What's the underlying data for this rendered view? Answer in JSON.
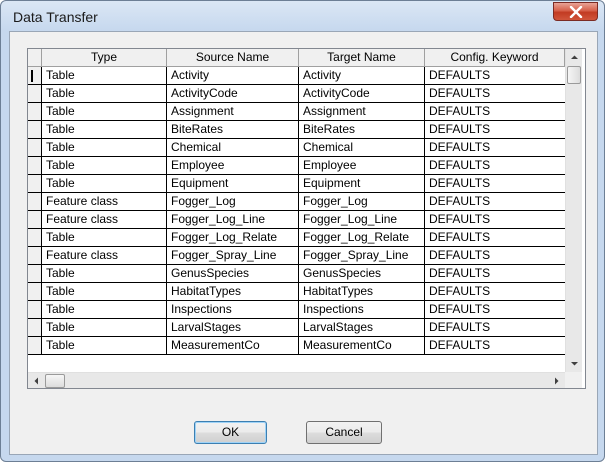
{
  "dialog": {
    "title": "Data Transfer",
    "ok_label": "OK",
    "cancel_label": "Cancel"
  },
  "grid": {
    "columns": [
      "Type",
      "Source Name",
      "Target Name",
      "Config. Keyword"
    ],
    "rows": [
      [
        "Table",
        "Activity",
        "Activity",
        "DEFAULTS"
      ],
      [
        "Table",
        "ActivityCode",
        "ActivityCode",
        "DEFAULTS"
      ],
      [
        "Table",
        "Assignment",
        "Assignment",
        "DEFAULTS"
      ],
      [
        "Table",
        "BiteRates",
        "BiteRates",
        "DEFAULTS"
      ],
      [
        "Table",
        "Chemical",
        "Chemical",
        "DEFAULTS"
      ],
      [
        "Table",
        "Employee",
        "Employee",
        "DEFAULTS"
      ],
      [
        "Table",
        "Equipment",
        "Equipment",
        "DEFAULTS"
      ],
      [
        "Feature class",
        "Fogger_Log",
        "Fogger_Log",
        "DEFAULTS"
      ],
      [
        "Feature class",
        "Fogger_Log_Line",
        "Fogger_Log_Line",
        "DEFAULTS"
      ],
      [
        "Table",
        "Fogger_Log_Relate",
        "Fogger_Log_Relate",
        "DEFAULTS"
      ],
      [
        "Feature class",
        "Fogger_Spray_Line",
        "Fogger_Spray_Line",
        "DEFAULTS"
      ],
      [
        "Table",
        "GenusSpecies",
        "GenusSpecies",
        "DEFAULTS"
      ],
      [
        "Table",
        "HabitatTypes",
        "HabitatTypes",
        "DEFAULTS"
      ],
      [
        "Table",
        "Inspections",
        "Inspections",
        "DEFAULTS"
      ],
      [
        "Table",
        "LarvalStages",
        "LarvalStages",
        "DEFAULTS"
      ],
      [
        "Table",
        "MeasurementCo",
        "MeasurementCo",
        "DEFAULTS"
      ]
    ]
  },
  "icons": {
    "close": "close-icon",
    "scroll_up": "arrow-up-icon",
    "scroll_down": "arrow-down-icon",
    "scroll_left": "arrow-left-icon",
    "scroll_right": "arrow-right-icon"
  }
}
